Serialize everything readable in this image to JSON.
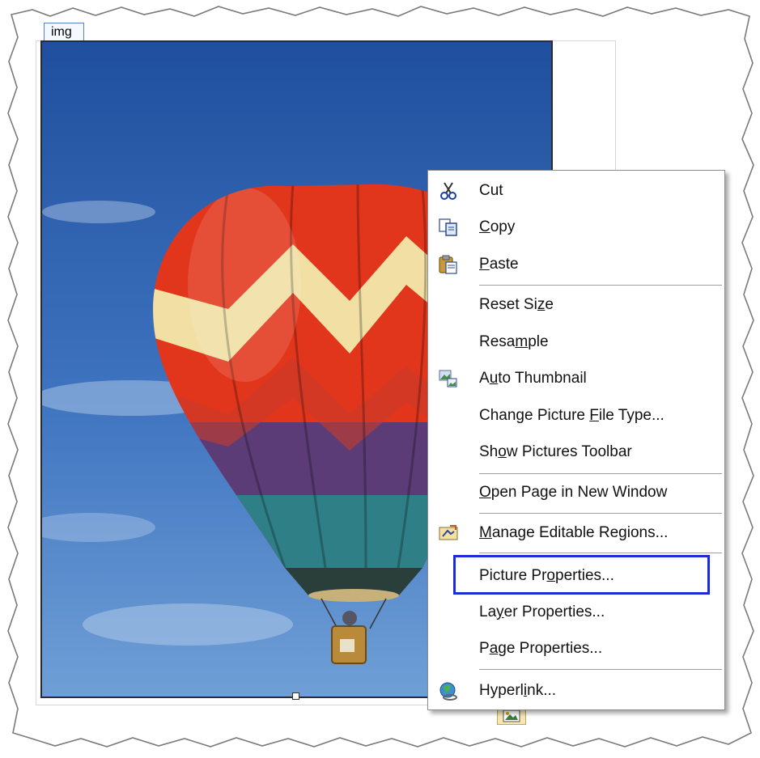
{
  "tag_label": "img",
  "menu": {
    "items": [
      {
        "id": "cut",
        "label": "Cut",
        "accel": 3
      },
      {
        "id": "copy",
        "label": "Copy",
        "accel": 0
      },
      {
        "id": "paste",
        "label": "Paste",
        "accel": 0
      },
      {
        "id": "reset-size",
        "label": "Reset Size",
        "accel": 8
      },
      {
        "id": "resample",
        "label": "Resample",
        "accel": 4
      },
      {
        "id": "auto-thumbnail",
        "label": "Auto Thumbnail",
        "accel": 1
      },
      {
        "id": "change-picture-file-type",
        "label": "Change Picture File Type...",
        "accel": 15
      },
      {
        "id": "show-pictures-toolbar",
        "label": "Show Pictures Toolbar",
        "accel": 2
      },
      {
        "id": "open-page-in-new-window",
        "label": "Open Page in New Window",
        "accel": 0
      },
      {
        "id": "manage-editable-regions",
        "label": "Manage Editable Regions...",
        "accel": 0
      },
      {
        "id": "picture-properties",
        "label": "Picture Properties...",
        "accel": 10
      },
      {
        "id": "layer-properties",
        "label": "Layer Properties...",
        "accel": 2
      },
      {
        "id": "page-properties",
        "label": "Page Properties...",
        "accel": 1
      },
      {
        "id": "hyperlink",
        "label": "Hyperlink...",
        "accel": 6
      }
    ],
    "highlighted": "picture-properties"
  },
  "colors": {
    "highlight_border": "#1b2bd6",
    "sky_top": "#1f4f9e",
    "sky_bottom": "#6f9fd6",
    "balloon_red": "#e2361c",
    "balloon_cream": "#f1dfa3",
    "balloon_purple": "#5b3c76",
    "balloon_teal": "#2f7f86"
  },
  "icons": {
    "cut": "scissors-icon",
    "copy": "copy-icon",
    "paste": "paste-icon",
    "auto-thumbnail": "thumbnail-icon",
    "manage-editable-regions": "editable-regions-icon",
    "hyperlink": "hyperlink-globe-icon",
    "smart-tag": "picture-actions-icon"
  }
}
